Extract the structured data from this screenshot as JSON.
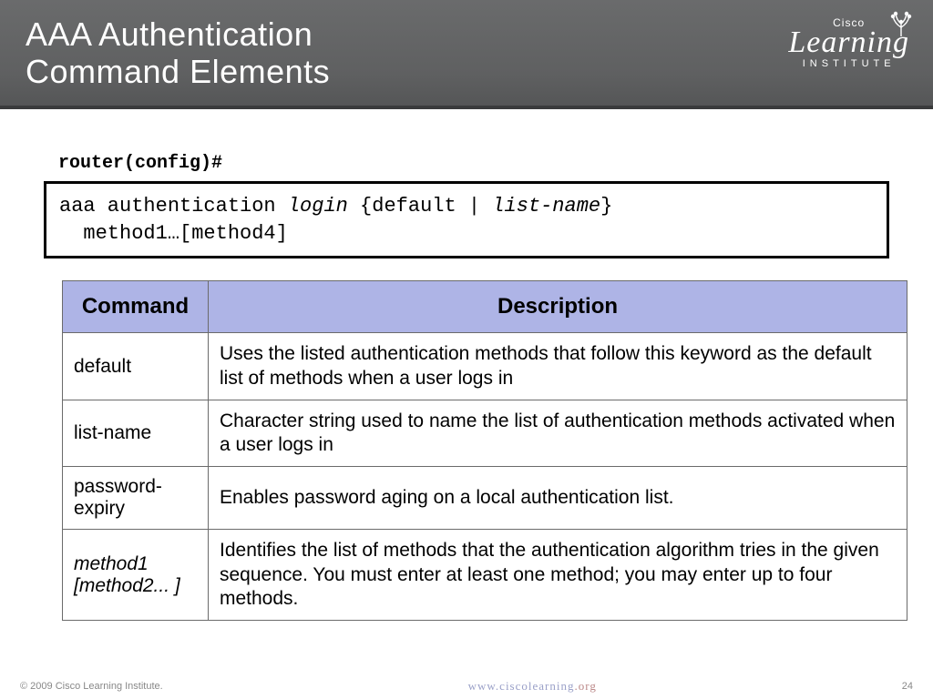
{
  "header": {
    "title_line1": "AAA Authentication",
    "title_line2": "Command Elements",
    "logo_top": "Cisco",
    "logo_mid": "Learning",
    "logo_bot": "INSTITUTE"
  },
  "prompt": "router(config)#",
  "command": {
    "prefix": "aaa authentication ",
    "ital1": "login",
    "mid": " {default | ",
    "ital2": "list-name",
    "close": "}",
    "line2_indent": "  method1…[method4]"
  },
  "table": {
    "head_cmd": "Command",
    "head_desc": "Description",
    "rows": [
      {
        "cmd": "default",
        "ital": false,
        "desc": "Uses the listed authentication methods that follow this keyword as the default list of methods when a user logs in"
      },
      {
        "cmd": "list-name",
        "ital": false,
        "desc": "Character string used to name the list of authentication methods activated when a user logs in"
      },
      {
        "cmd": "password-expiry",
        "ital": false,
        "desc": "Enables password aging on a local authentication list."
      },
      {
        "cmd": "method1 [method2... ]",
        "ital": true,
        "desc": "Identifies the list of methods that the authentication algorithm tries in the given sequence. You must enter at least one method; you may enter up to four methods."
      }
    ]
  },
  "footer": {
    "copyright": "© 2009 Cisco Learning Institute.",
    "url_pre": "www.ciscolearning",
    "url_suf": ".org",
    "page": "24"
  }
}
